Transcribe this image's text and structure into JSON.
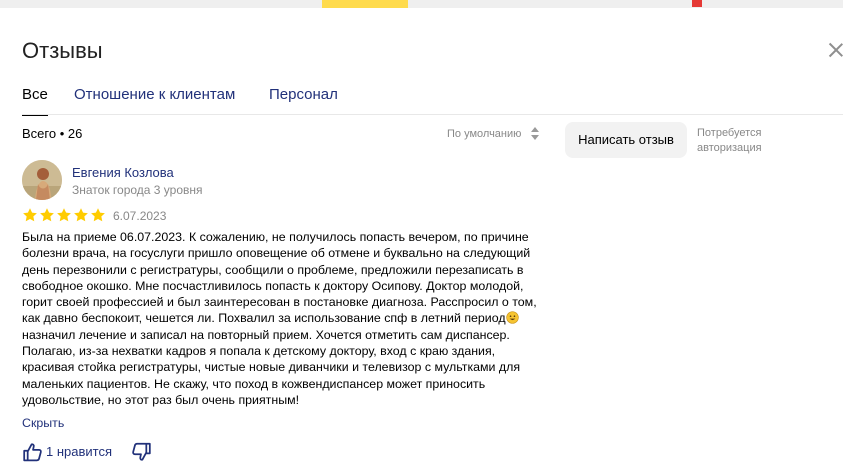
{
  "header": {
    "title": "Отзывы"
  },
  "tabs": [
    {
      "label": "Все",
      "active": true
    },
    {
      "label": "Отношение к клиентам",
      "active": false
    },
    {
      "label": "Персонал",
      "active": false
    }
  ],
  "summary": {
    "total_label": "Всего • 26"
  },
  "sort": {
    "label": "По умолчанию"
  },
  "write_review": {
    "button_label": "Написать отзыв",
    "auth_note_line1": "Потребуется",
    "auth_note_line2": "авторизация"
  },
  "review": {
    "author": "Евгения Козлова",
    "author_level": "Знаток города 3 уровня",
    "rating": 5,
    "date": "6.07.2023",
    "text_part1": "Была на приеме 06.07.2023. К сожалению, не получилось попасть вечером, по причине болезни врача, на госуслуги пришло оповещение об отмене и буквально на следующий день перезвонили с регистратуры, сообщили о проблеме, предложили перезаписать в свободное окошко. Мне посчастливилось попасть к доктору Осипову. Доктор молодой, горит своей профессией и был заинтересован в постановке диагноза. Расспросил о том, как давно беспокоит, чешется ли. Похвалил за использование спф в летний период",
    "text_part2": " назначил лечение и записал на повторный прием. Хочется отметить сам диспансер. Полагаю, из-за нехватки кадров я попала к детскому доктору, вход с краю здания, красивая стойка регистратуры, чистые новые диванчики и телевизор с мультками для маленьких пациентов. Не скажу, что поход в кожвендиспансер может приносить удовольствие, но этот раз был очень приятным!",
    "collapse_label": "Скрыть",
    "likes_label": "1 нравится"
  },
  "icons": {
    "close": "close-icon",
    "sort": "sort-arrows-icon",
    "star": "star-icon",
    "emoji": "smiley-icon",
    "like": "thumbs-up-icon",
    "dislike": "thumbs-down-icon"
  },
  "colors": {
    "link": "#21317a",
    "star": "#ffcc00",
    "muted": "#888888",
    "button_bg": "#f2f2f2"
  }
}
